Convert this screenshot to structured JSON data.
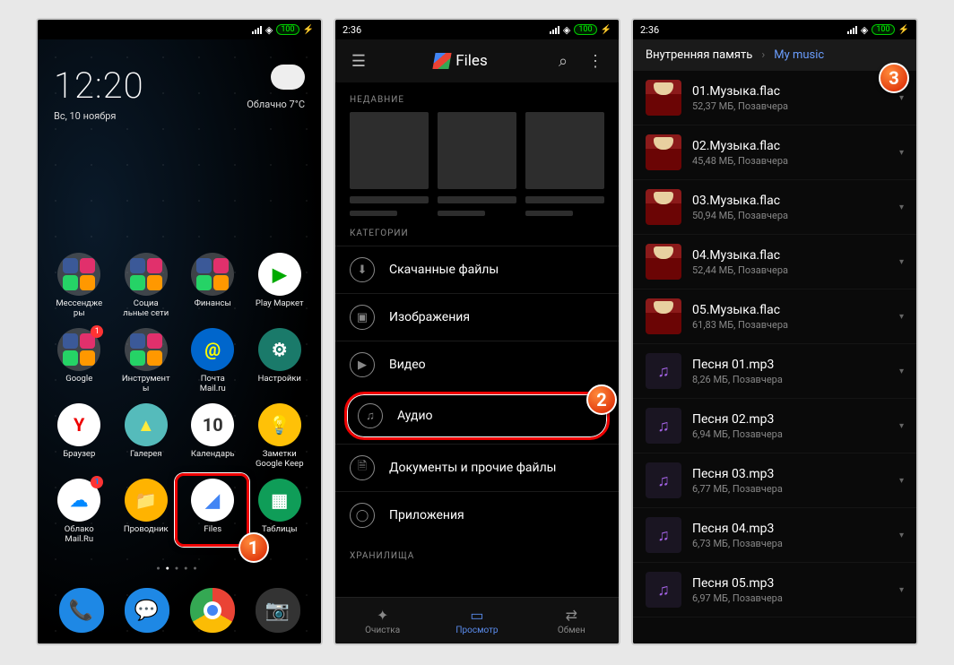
{
  "status": {
    "time": "2:36",
    "battery": "100"
  },
  "screen1": {
    "clock": "12:20",
    "date": "Вс, 10 ноября",
    "weather": "Облачно  7°C",
    "apps": [
      {
        "label": "Мессендже\nры",
        "type": "folder"
      },
      {
        "label": "Социа\nльные сети",
        "type": "folder"
      },
      {
        "label": "Финансы",
        "type": "folder"
      },
      {
        "label": "Play Маркет",
        "icon": "▶",
        "bg": "#fff",
        "fg": "#0a0"
      },
      {
        "label": "Google",
        "type": "folder",
        "badge": "1"
      },
      {
        "label": "Инструмент\nы",
        "type": "folder"
      },
      {
        "label": "Почта\nMail.ru",
        "icon": "@",
        "bg": "#06c",
        "fg": "#ff0"
      },
      {
        "label": "Настройки",
        "icon": "⚙",
        "bg": "#1a7a6a",
        "fg": "#fff"
      },
      {
        "label": "Браузер",
        "icon": "Y",
        "bg": "#fff",
        "fg": "#e00"
      },
      {
        "label": "Галерея",
        "icon": "▲",
        "bg": "#5bb",
        "fg": "#ffeb3b"
      },
      {
        "label": "Календарь",
        "icon": "10",
        "bg": "#fff",
        "fg": "#333"
      },
      {
        "label": "Заметки\nGoogle Keep",
        "icon": "💡",
        "bg": "#ffc107",
        "fg": "#fff"
      },
      {
        "label": "Облако\nMail.Ru",
        "icon": "☁",
        "bg": "#fff",
        "fg": "#08f",
        "badge": "1"
      },
      {
        "label": "Проводник",
        "icon": "📁",
        "bg": "#ffb300",
        "fg": "#fff"
      },
      {
        "label": "Files",
        "icon": "◢",
        "bg": "#fff",
        "fg": "#4285f4"
      },
      {
        "label": "Таблицы",
        "icon": "▦",
        "bg": "#0f9d58",
        "fg": "#fff"
      }
    ],
    "dock": [
      {
        "icon": "📞",
        "bg": "#1e88e5"
      },
      {
        "icon": "💬",
        "bg": "#1e88e5"
      },
      {
        "icon": "●",
        "bg": "#fff",
        "chrome": true
      },
      {
        "icon": "📷",
        "bg": "#333"
      }
    ],
    "step": "1"
  },
  "screen2": {
    "title": "Files",
    "sections": {
      "recent": "НЕДАВНИЕ",
      "categories": "КАТЕГОРИИ",
      "storages": "ХРАНИЛИЩА"
    },
    "categories": [
      {
        "label": "Скачанные файлы",
        "icon": "⬇"
      },
      {
        "label": "Изображения",
        "icon": "▣"
      },
      {
        "label": "Видео",
        "icon": "▶"
      },
      {
        "label": "Аудио",
        "icon": "♫",
        "highlighted": true
      },
      {
        "label": "Документы и прочие файлы",
        "icon": "🗎"
      },
      {
        "label": "Приложения",
        "icon": "◯"
      }
    ],
    "nav": [
      {
        "label": "Очистка",
        "icon": "✦"
      },
      {
        "label": "Просмотр",
        "icon": "▭",
        "active": true
      },
      {
        "label": "Обмен",
        "icon": "⇄"
      }
    ],
    "step": "2"
  },
  "screen3": {
    "crumb_root": "Внутренняя память",
    "crumb_active": "My music",
    "files": [
      {
        "name": "01.Музыка.flac",
        "meta": "52,37 МБ, Позавчера",
        "art": true
      },
      {
        "name": "02.Музыка.flac",
        "meta": "45,48 МБ, Позавчера",
        "art": true
      },
      {
        "name": "03.Музыка.flac",
        "meta": "50,94 МБ, Позавчера",
        "art": true
      },
      {
        "name": "04.Музыка.flac",
        "meta": "52,44 МБ, Позавчера",
        "art": true
      },
      {
        "name": "05.Музыка.flac",
        "meta": "61,83 МБ, Позавчера",
        "art": true
      },
      {
        "name": "Песня 01.mp3",
        "meta": "8,26 МБ, Позавчера"
      },
      {
        "name": "Песня 02.mp3",
        "meta": "6,94 МБ, Позавчера"
      },
      {
        "name": "Песня 03.mp3",
        "meta": "6,77 МБ, Позавчера"
      },
      {
        "name": "Песня 04.mp3",
        "meta": "6,73 МБ, Позавчера"
      },
      {
        "name": "Песня 05.mp3",
        "meta": "6,97 МБ, Позавчера"
      }
    ],
    "step": "3"
  }
}
